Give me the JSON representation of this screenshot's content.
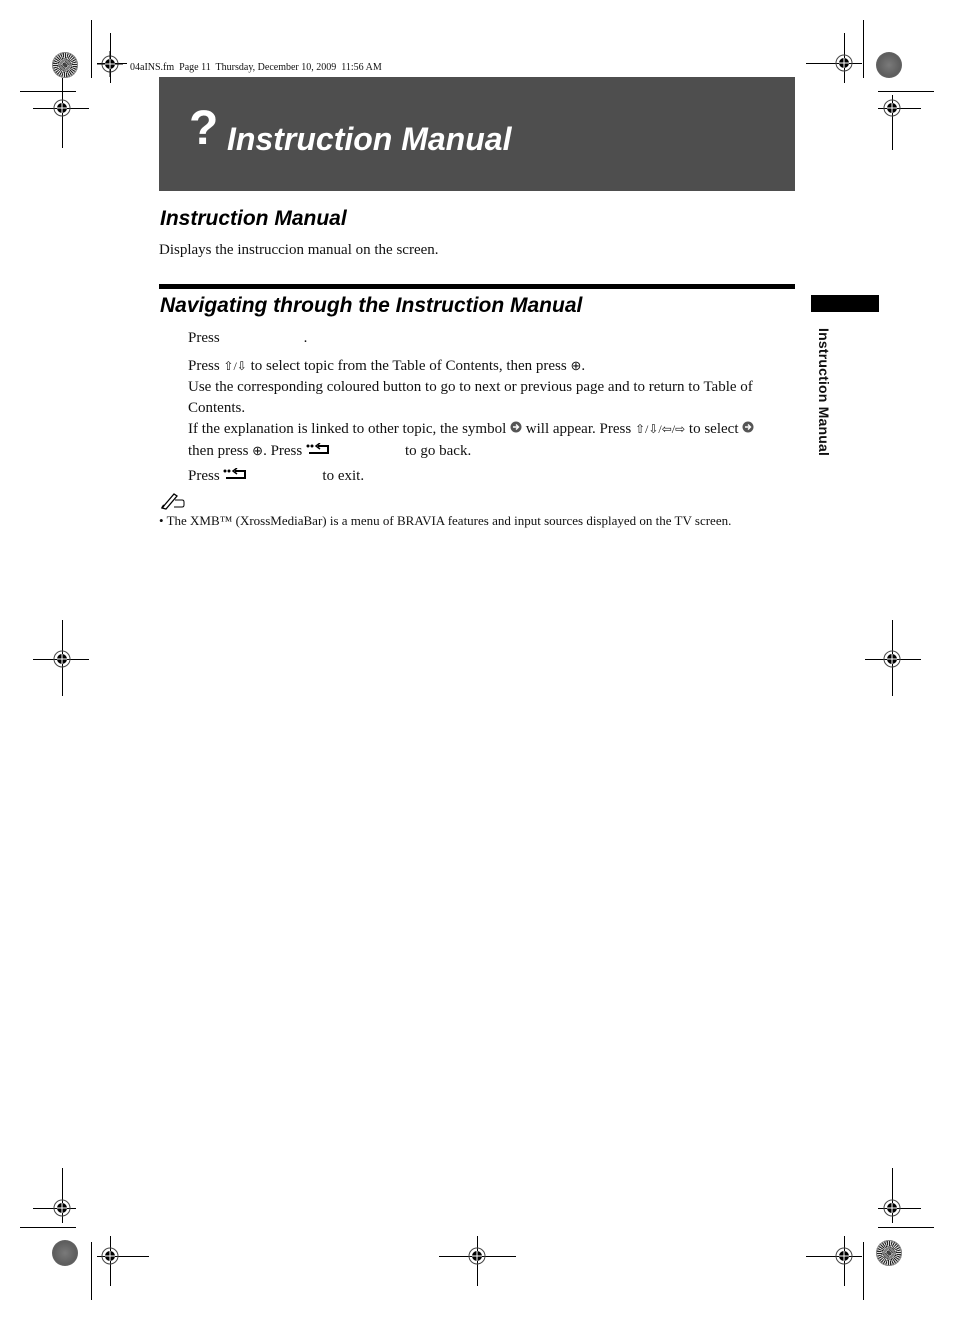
{
  "header_slug": "04aINS.fm  Page 11  Thursday, December 10, 2009  11:56 AM",
  "banner": {
    "symbol": "?",
    "title": "Instruction Manual"
  },
  "section1": {
    "heading": "Instruction Manual",
    "description": "Displays the instruccion manual on the screen."
  },
  "section2": {
    "heading": "Navigating through the Instruction Manual",
    "steps": {
      "step1": {
        "prefix": "Press",
        "suffix": "."
      },
      "step2": {
        "line1_a": "Press ",
        "line1_b": " to select topic from the Table of Contents, then press ",
        "line1_c": ".",
        "line2": "Use the corresponding coloured button to go to next or previous page and to return to Table of Contents.",
        "line3_a": "If the explanation is linked to other topic, the symbol ",
        "line3_b": " will appear. Press ",
        "line3_c": " to select ",
        "line4_a": "then press ",
        "line4_b": ". Press ",
        "line4_c": "to go back."
      },
      "step3": {
        "prefix": "Press ",
        "suffix": "to exit."
      }
    },
    "icons": {
      "up_down": "⇧/⇩",
      "up_down_left_right": "⇧/⇩/⇦/⇨",
      "enter": "⊕",
      "link": "➔",
      "return": "return-icon"
    }
  },
  "note": {
    "icon": "pencil-note-icon",
    "text": "• The XMB™ (XrossMediaBar) is a menu of BRAVIA features and input sources displayed on the TV screen."
  },
  "side_tab": {
    "label": "Instruction Manual"
  }
}
